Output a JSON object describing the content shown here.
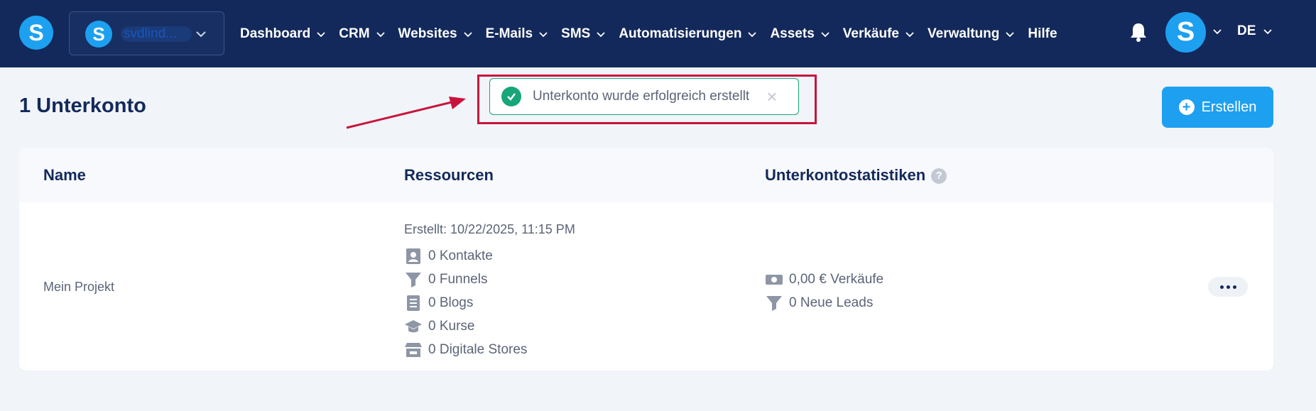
{
  "nav": {
    "logo_letter": "S",
    "account": {
      "logo_letter": "S",
      "name": "svdlind..."
    },
    "menu": [
      {
        "label": "Dashboard",
        "chevron": true
      },
      {
        "label": "CRM",
        "chevron": true
      },
      {
        "label": "Websites",
        "chevron": true
      },
      {
        "label": "E-Mails",
        "chevron": true
      },
      {
        "label": "SMS",
        "chevron": true
      },
      {
        "label": "Automatisierungen",
        "chevron": true
      },
      {
        "label": "Assets",
        "chevron": true
      },
      {
        "label": "Verkäufe",
        "chevron": true
      },
      {
        "label": "Verwaltung",
        "chevron": true
      },
      {
        "label": "Hilfe",
        "chevron": false
      }
    ],
    "user_avatar_letter": "S",
    "language": "DE"
  },
  "page": {
    "title": "1 Unterkonto",
    "create_button": "Erstellen"
  },
  "toast": {
    "message": "Unterkonto wurde erfolgreich erstellt",
    "close": "×"
  },
  "table": {
    "headers": {
      "name": "Name",
      "resources": "Ressourcen",
      "stats": "Unterkontostatistiken",
      "help": "?"
    },
    "rows": [
      {
        "name": "Mein Projekt",
        "created": "Erstellt: 10/22/2025, 11:15 PM",
        "resources": [
          {
            "icon": "contacts-icon",
            "label": "0 Kontakte"
          },
          {
            "icon": "funnel-icon",
            "label": "0 Funnels"
          },
          {
            "icon": "blog-icon",
            "label": "0 Blogs"
          },
          {
            "icon": "course-icon",
            "label": "0 Kurse"
          },
          {
            "icon": "store-icon",
            "label": "0 Digitale Stores"
          }
        ],
        "stats": [
          {
            "icon": "money-icon",
            "label": "0,00 € Verkäufe"
          },
          {
            "icon": "funnel-icon",
            "label": "0 Neue Leads"
          }
        ]
      }
    ]
  },
  "colors": {
    "navbar": "#13295b",
    "brand_blue": "#1ea0f0",
    "success": "#17a57a",
    "annotation_red": "#c8143c",
    "background": "#f1f4f9"
  }
}
